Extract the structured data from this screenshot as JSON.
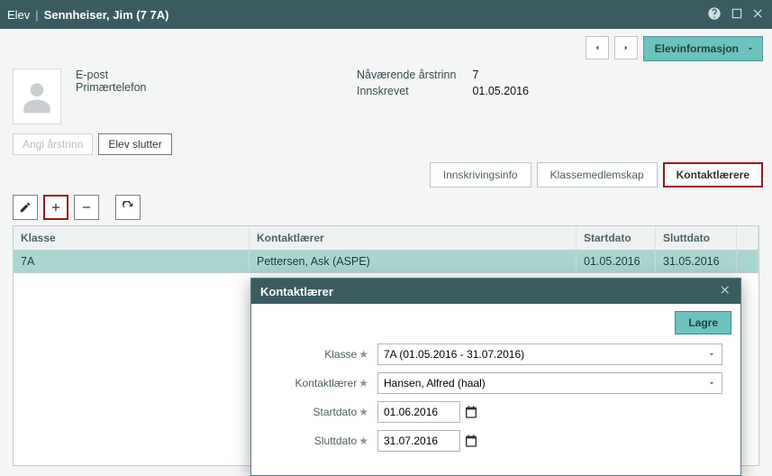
{
  "titlebar": {
    "prefix": "Elev",
    "name": "Sennheiser, Jim (7 7A)"
  },
  "toolbar": {
    "view_label": "Elevinformasjon"
  },
  "info": {
    "epost_label": "E-post",
    "primtel_label": "Primærtelefon",
    "grade_label": "Nåværende årstrinn",
    "grade_value": "7",
    "enrolled_label": "Innskrevet",
    "enrolled_value": "01.05.2016"
  },
  "actions": {
    "set_grade": "Angi årstrinn",
    "student_leaves": "Elev slutter"
  },
  "tabs": {
    "enrollment": "Innskrivingsinfo",
    "class_membership": "Klassemedlemskap",
    "contact_teachers": "Kontaktlærere"
  },
  "grid": {
    "headers": {
      "klasse": "Klasse",
      "kontaktlaerer": "Kontaktlærer",
      "start": "Startdato",
      "slutt": "Sluttdato"
    },
    "rows": [
      {
        "klasse": "7A",
        "kontaktlaerer": "Pettersen, Ask (ASPE)",
        "start": "01.05.2016",
        "slutt": "31.05.2016"
      }
    ]
  },
  "modal": {
    "title": "Kontaktlærer",
    "save": "Lagre",
    "labels": {
      "klasse": "Klasse",
      "kontaktlaerer": "Kontaktlærer",
      "start": "Startdato",
      "slutt": "Sluttdato"
    },
    "values": {
      "klasse": "7A (01.05.2016 - 31.07.2016)",
      "kontaktlaerer": "Hansen, Alfred (haal)",
      "start": "01.06.2016",
      "slutt": "31.07.2016"
    }
  }
}
